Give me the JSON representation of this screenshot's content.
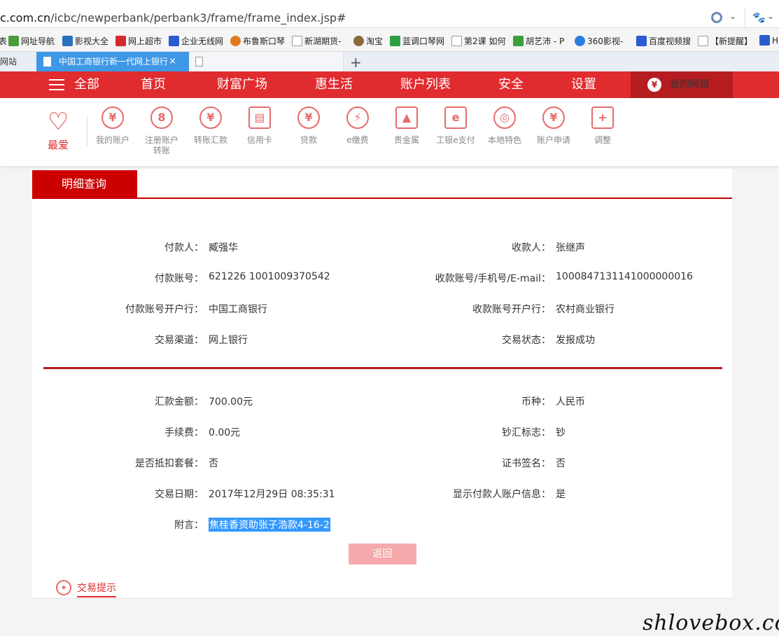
{
  "browser": {
    "url_domain": "c.com.cn",
    "url_path": "/icbc/newperbank/perbank3/frame/frame_index.jsp#",
    "bookmarks": [
      {
        "label": "网址导航",
        "color": "#4a9d3a"
      },
      {
        "label": "影视大全",
        "color": "#2c6fba"
      },
      {
        "label": "网上超市",
        "color": "#d62b2b"
      },
      {
        "label": "企业无线网",
        "color": "#2b5bd0"
      },
      {
        "label": "布鲁斯口琴",
        "color": "#e07a1f"
      },
      {
        "label": "新湖期货-",
        "color": "#999999"
      },
      {
        "label": "淘宝",
        "color": "#8a6a3a"
      },
      {
        "label": "蓝调口琴网",
        "color": "#2e9e44"
      },
      {
        "label": "第2课 如何",
        "color": "#999999"
      },
      {
        "label": "胡艺沛 - P",
        "color": "#3aa03a"
      },
      {
        "label": "360影视-",
        "color": "#2a7de1"
      },
      {
        "label": "百度视频搜",
        "color": "#2b5bd0"
      },
      {
        "label": "【新提醒】",
        "color": "#999999"
      },
      {
        "label": "H",
        "color": "#2b5bd0"
      }
    ],
    "bookmark_prefix": "表",
    "tabs": [
      {
        "label": "网站"
      },
      {
        "label": "中国工商银行新一代网上银行"
      },
      {
        "label": ""
      }
    ],
    "tab_close": "×",
    "tab_plus": "+"
  },
  "nav": {
    "menu_label": "全部",
    "items": [
      "首页",
      "财富广场",
      "惠生活",
      "账户列表",
      "安全",
      "设置"
    ],
    "mine_label": "我的网银",
    "mine_icon": "¥"
  },
  "toolbar": {
    "fav_label": "最爱",
    "items": [
      {
        "label": "我的账户",
        "glyph": "¥"
      },
      {
        "label": "注册账户转账",
        "glyph": "8"
      },
      {
        "label": "转账汇款",
        "glyph": "¥"
      },
      {
        "label": "信用卡",
        "glyph": "▤"
      },
      {
        "label": "贷款",
        "glyph": "¥"
      },
      {
        "label": "e缴费",
        "glyph": "⚡"
      },
      {
        "label": "贵金属",
        "glyph": "▲"
      },
      {
        "label": "工银e支付",
        "glyph": "e"
      },
      {
        "label": "本地特色",
        "glyph": "◎"
      },
      {
        "label": "账户申请",
        "glyph": "¥"
      },
      {
        "label": "调整",
        "glyph": "+"
      }
    ]
  },
  "detail": {
    "tab_title": "明细查询",
    "payer_label": "付款人：",
    "payer": "臧强华",
    "payee_label": "收款人：",
    "payee": "张继声",
    "payer_account_label": "付款账号：",
    "payer_account": "621226 1001009370542",
    "payee_account_label": "收款账号/手机号/E-mail：",
    "payee_account": "1000847131141000000016",
    "payer_bank_label": "付款账号开户行：",
    "payer_bank": "中国工商银行",
    "payee_bank_label": "收款账号开户行：",
    "payee_bank": "农村商业银行",
    "channel_label": "交易渠道：",
    "channel": "网上银行",
    "status_label": "交易状态：",
    "status": "发报成功",
    "amount_label": "汇款金额：",
    "amount": "700.00元",
    "currency_label": "币种：",
    "currency": "人民币",
    "fee_label": "手续费：",
    "fee": "0.00元",
    "cash_flag_label": "钞汇标志：",
    "cash_flag": "钞",
    "package_label": "是否抵扣套餐：",
    "package": "否",
    "cert_label": "证书签名：",
    "cert": "否",
    "date_label": "交易日期：",
    "date": "2017年12月29日 08:35:31",
    "show_payer_label": "显示付款人账户信息：",
    "show_payer": "是",
    "memo_label": "附言：",
    "memo": "焦桂香资助张子浩款4-16-2",
    "back_button": "返回",
    "tips_label": "交易提示"
  },
  "watermark": "shlovebox.com"
}
